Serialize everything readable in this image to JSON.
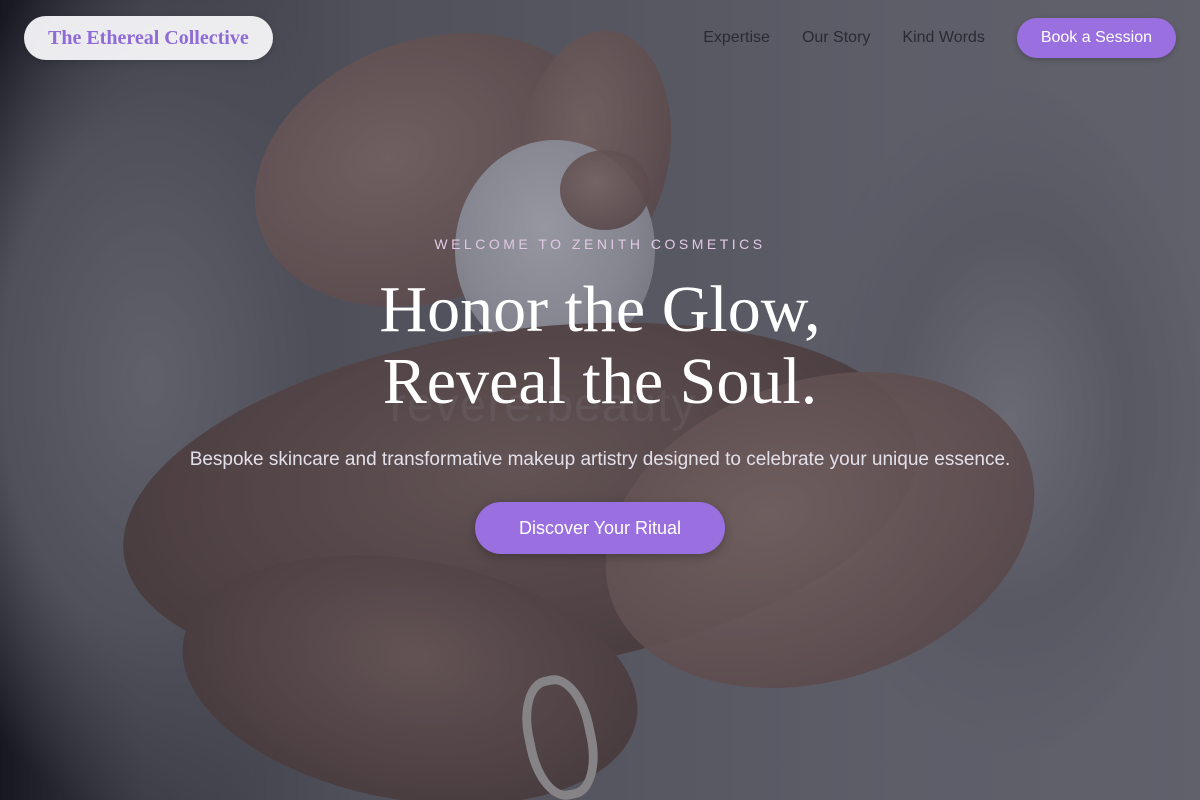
{
  "brand": {
    "name": "The Ethereal Collective"
  },
  "nav": {
    "links": [
      "Expertise",
      "Our Story",
      "Kind Words"
    ],
    "cta_label": "Book a Session"
  },
  "hero": {
    "eyebrow": "Welcome to Zenith Cosmetics",
    "headline_line1": "Honor the Glow,",
    "headline_line2": "Reveal the Soul.",
    "subtitle": "Bespoke skincare and transformative makeup artistry designed to celebrate your unique essence.",
    "cta_label": "Discover Your Ritual",
    "background_watermark": "revere.beauty"
  },
  "colors": {
    "accent": "#9a6fe0",
    "logo_text": "#8e6bd6",
    "eyebrow": "#e0c8e4"
  }
}
